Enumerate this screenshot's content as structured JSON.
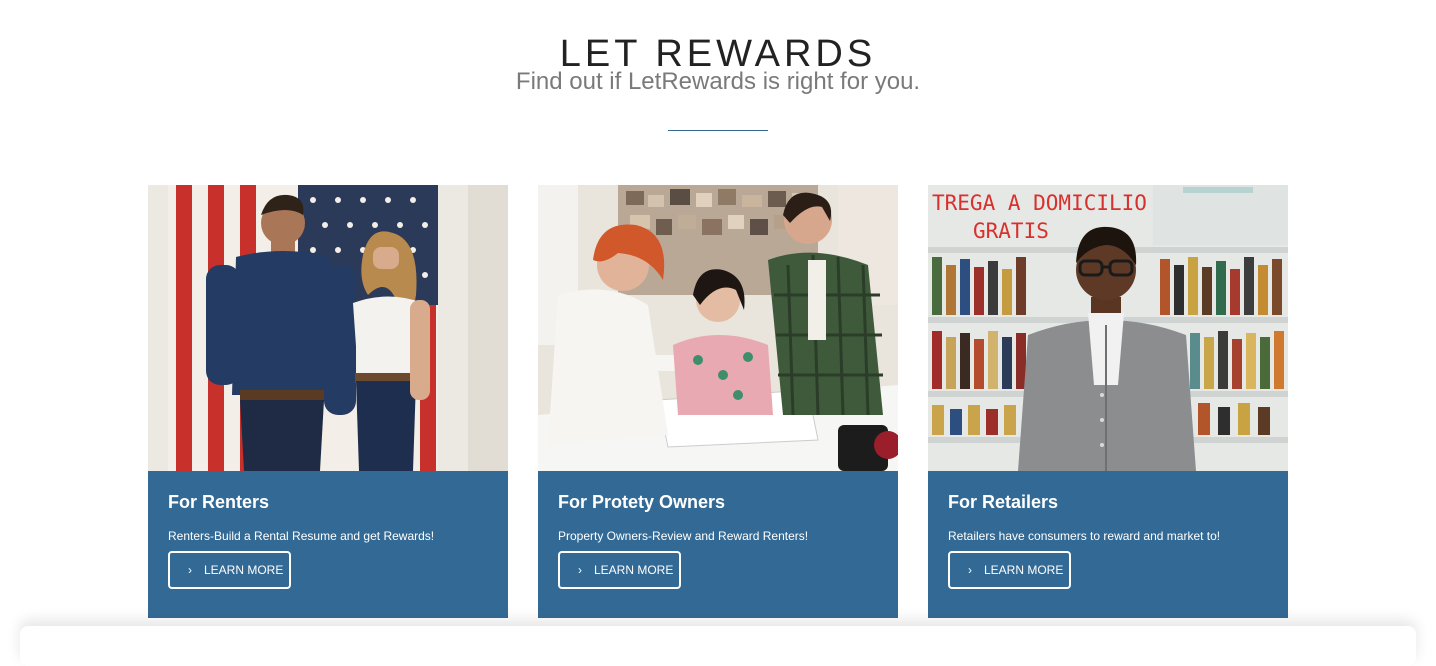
{
  "section": {
    "heading": "LET REWARDS",
    "subheading": "Find out if LetRewards is right for you.",
    "accent_color": "#336a95"
  },
  "cards": [
    {
      "title": "For Renters",
      "description": "Renters-Build a Rental Resume and get Rewards!",
      "button_icon": "›",
      "button_label": "LEARN MORE"
    },
    {
      "title": "For Protety Owners",
      "description": "Property Owners-Review and Reward Renters!",
      "button_icon": "›",
      "button_label": "LEARN MORE"
    },
    {
      "title": "For Retailers",
      "description": "Retailers have consumers to reward and market to!",
      "button_icon": "›",
      "button_label": "LEARN MORE"
    }
  ],
  "retail_photo_sign": {
    "line1": "TREGA A DOMICILIO",
    "line2": "GRATIS"
  }
}
